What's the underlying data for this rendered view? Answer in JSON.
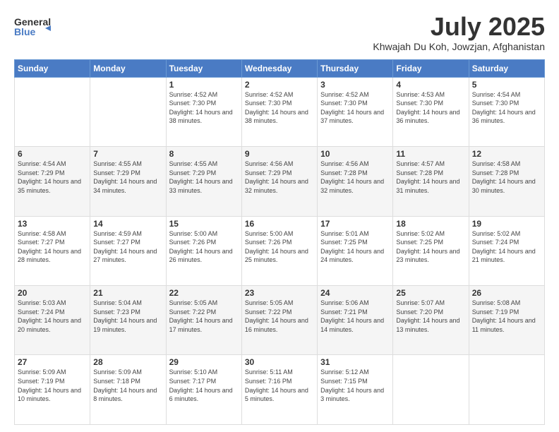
{
  "logo": {
    "general": "General",
    "blue": "Blue"
  },
  "header": {
    "month": "July 2025",
    "location": "Khwajah Du Koh, Jowzjan, Afghanistan"
  },
  "days_of_week": [
    "Sunday",
    "Monday",
    "Tuesday",
    "Wednesday",
    "Thursday",
    "Friday",
    "Saturday"
  ],
  "weeks": [
    [
      {
        "day": "",
        "sunrise": "",
        "sunset": "",
        "daylight": ""
      },
      {
        "day": "",
        "sunrise": "",
        "sunset": "",
        "daylight": ""
      },
      {
        "day": "1",
        "sunrise": "Sunrise: 4:52 AM",
        "sunset": "Sunset: 7:30 PM",
        "daylight": "Daylight: 14 hours and 38 minutes."
      },
      {
        "day": "2",
        "sunrise": "Sunrise: 4:52 AM",
        "sunset": "Sunset: 7:30 PM",
        "daylight": "Daylight: 14 hours and 38 minutes."
      },
      {
        "day": "3",
        "sunrise": "Sunrise: 4:52 AM",
        "sunset": "Sunset: 7:30 PM",
        "daylight": "Daylight: 14 hours and 37 minutes."
      },
      {
        "day": "4",
        "sunrise": "Sunrise: 4:53 AM",
        "sunset": "Sunset: 7:30 PM",
        "daylight": "Daylight: 14 hours and 36 minutes."
      },
      {
        "day": "5",
        "sunrise": "Sunrise: 4:54 AM",
        "sunset": "Sunset: 7:30 PM",
        "daylight": "Daylight: 14 hours and 36 minutes."
      }
    ],
    [
      {
        "day": "6",
        "sunrise": "Sunrise: 4:54 AM",
        "sunset": "Sunset: 7:29 PM",
        "daylight": "Daylight: 14 hours and 35 minutes."
      },
      {
        "day": "7",
        "sunrise": "Sunrise: 4:55 AM",
        "sunset": "Sunset: 7:29 PM",
        "daylight": "Daylight: 14 hours and 34 minutes."
      },
      {
        "day": "8",
        "sunrise": "Sunrise: 4:55 AM",
        "sunset": "Sunset: 7:29 PM",
        "daylight": "Daylight: 14 hours and 33 minutes."
      },
      {
        "day": "9",
        "sunrise": "Sunrise: 4:56 AM",
        "sunset": "Sunset: 7:29 PM",
        "daylight": "Daylight: 14 hours and 32 minutes."
      },
      {
        "day": "10",
        "sunrise": "Sunrise: 4:56 AM",
        "sunset": "Sunset: 7:28 PM",
        "daylight": "Daylight: 14 hours and 32 minutes."
      },
      {
        "day": "11",
        "sunrise": "Sunrise: 4:57 AM",
        "sunset": "Sunset: 7:28 PM",
        "daylight": "Daylight: 14 hours and 31 minutes."
      },
      {
        "day": "12",
        "sunrise": "Sunrise: 4:58 AM",
        "sunset": "Sunset: 7:28 PM",
        "daylight": "Daylight: 14 hours and 30 minutes."
      }
    ],
    [
      {
        "day": "13",
        "sunrise": "Sunrise: 4:58 AM",
        "sunset": "Sunset: 7:27 PM",
        "daylight": "Daylight: 14 hours and 28 minutes."
      },
      {
        "day": "14",
        "sunrise": "Sunrise: 4:59 AM",
        "sunset": "Sunset: 7:27 PM",
        "daylight": "Daylight: 14 hours and 27 minutes."
      },
      {
        "day": "15",
        "sunrise": "Sunrise: 5:00 AM",
        "sunset": "Sunset: 7:26 PM",
        "daylight": "Daylight: 14 hours and 26 minutes."
      },
      {
        "day": "16",
        "sunrise": "Sunrise: 5:00 AM",
        "sunset": "Sunset: 7:26 PM",
        "daylight": "Daylight: 14 hours and 25 minutes."
      },
      {
        "day": "17",
        "sunrise": "Sunrise: 5:01 AM",
        "sunset": "Sunset: 7:25 PM",
        "daylight": "Daylight: 14 hours and 24 minutes."
      },
      {
        "day": "18",
        "sunrise": "Sunrise: 5:02 AM",
        "sunset": "Sunset: 7:25 PM",
        "daylight": "Daylight: 14 hours and 23 minutes."
      },
      {
        "day": "19",
        "sunrise": "Sunrise: 5:02 AM",
        "sunset": "Sunset: 7:24 PM",
        "daylight": "Daylight: 14 hours and 21 minutes."
      }
    ],
    [
      {
        "day": "20",
        "sunrise": "Sunrise: 5:03 AM",
        "sunset": "Sunset: 7:24 PM",
        "daylight": "Daylight: 14 hours and 20 minutes."
      },
      {
        "day": "21",
        "sunrise": "Sunrise: 5:04 AM",
        "sunset": "Sunset: 7:23 PM",
        "daylight": "Daylight: 14 hours and 19 minutes."
      },
      {
        "day": "22",
        "sunrise": "Sunrise: 5:05 AM",
        "sunset": "Sunset: 7:22 PM",
        "daylight": "Daylight: 14 hours and 17 minutes."
      },
      {
        "day": "23",
        "sunrise": "Sunrise: 5:05 AM",
        "sunset": "Sunset: 7:22 PM",
        "daylight": "Daylight: 14 hours and 16 minutes."
      },
      {
        "day": "24",
        "sunrise": "Sunrise: 5:06 AM",
        "sunset": "Sunset: 7:21 PM",
        "daylight": "Daylight: 14 hours and 14 minutes."
      },
      {
        "day": "25",
        "sunrise": "Sunrise: 5:07 AM",
        "sunset": "Sunset: 7:20 PM",
        "daylight": "Daylight: 14 hours and 13 minutes."
      },
      {
        "day": "26",
        "sunrise": "Sunrise: 5:08 AM",
        "sunset": "Sunset: 7:19 PM",
        "daylight": "Daylight: 14 hours and 11 minutes."
      }
    ],
    [
      {
        "day": "27",
        "sunrise": "Sunrise: 5:09 AM",
        "sunset": "Sunset: 7:19 PM",
        "daylight": "Daylight: 14 hours and 10 minutes."
      },
      {
        "day": "28",
        "sunrise": "Sunrise: 5:09 AM",
        "sunset": "Sunset: 7:18 PM",
        "daylight": "Daylight: 14 hours and 8 minutes."
      },
      {
        "day": "29",
        "sunrise": "Sunrise: 5:10 AM",
        "sunset": "Sunset: 7:17 PM",
        "daylight": "Daylight: 14 hours and 6 minutes."
      },
      {
        "day": "30",
        "sunrise": "Sunrise: 5:11 AM",
        "sunset": "Sunset: 7:16 PM",
        "daylight": "Daylight: 14 hours and 5 minutes."
      },
      {
        "day": "31",
        "sunrise": "Sunrise: 5:12 AM",
        "sunset": "Sunset: 7:15 PM",
        "daylight": "Daylight: 14 hours and 3 minutes."
      },
      {
        "day": "",
        "sunrise": "",
        "sunset": "",
        "daylight": ""
      },
      {
        "day": "",
        "sunrise": "",
        "sunset": "",
        "daylight": ""
      }
    ]
  ]
}
